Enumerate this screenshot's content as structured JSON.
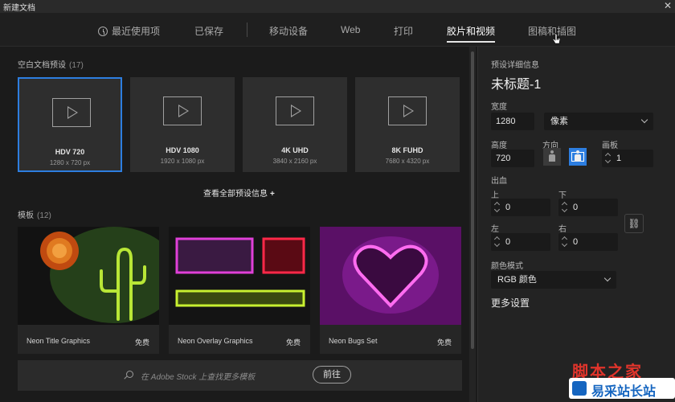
{
  "window": {
    "title": "新建文档",
    "close": "✕"
  },
  "tabs": [
    {
      "label": "最近使用项",
      "active": false
    },
    {
      "label": "已保存",
      "active": false
    },
    {
      "label": "移动设备",
      "active": false
    },
    {
      "label": "Web",
      "active": false
    },
    {
      "label": "打印",
      "active": false
    },
    {
      "label": "胶片和视频",
      "active": true
    },
    {
      "label": "图稿和插图",
      "active": false
    }
  ],
  "blank_presets": {
    "heading": "空白文档预设",
    "count": "(17)",
    "items": [
      {
        "name": "HDV 720",
        "size": "1280 x 720 px",
        "selected": true
      },
      {
        "name": "HDV 1080",
        "size": "1920 x 1080 px",
        "selected": false
      },
      {
        "name": "4K UHD",
        "size": "3840 x 2160 px",
        "selected": false
      },
      {
        "name": "8K FUHD",
        "size": "7680 x 4320 px",
        "selected": false
      }
    ],
    "view_all": "查看全部预设信息",
    "view_all_plus": "+"
  },
  "templates": {
    "heading": "模板",
    "count": "(12)",
    "items": [
      {
        "name": "Neon Title Graphics",
        "price": "免费"
      },
      {
        "name": "Neon Overlay Graphics",
        "price": "免费"
      },
      {
        "name": "Neon Bugs Set",
        "price": "免费"
      }
    ]
  },
  "stock": {
    "placeholder": "在 Adobe Stock 上查找更多模板",
    "go_label": "前往"
  },
  "details": {
    "heading": "预设详细信息",
    "doc_name": "未标题-1",
    "width_label": "宽度",
    "width_value": "1280",
    "unit": "像素",
    "height_label": "高度",
    "height_value": "720",
    "orientation_label": "方向",
    "artboard_label": "画板",
    "artboard_value": "1",
    "bleed_label": "出血",
    "bleed": {
      "top_label": "上",
      "top": "0",
      "bottom_label": "下",
      "bottom": "0",
      "left_label": "左",
      "left": "0",
      "right_label": "右",
      "right": "0"
    },
    "color_mode_label": "颜色模式",
    "color_mode": "RGB 颜色",
    "more_settings": "更多设置"
  },
  "watermark": {
    "top": "脚本之家",
    "bottom": "易采站长站"
  },
  "colors": {
    "accent": "#2d7ee0",
    "panel": "#232323",
    "card": "#2e2e2e"
  }
}
